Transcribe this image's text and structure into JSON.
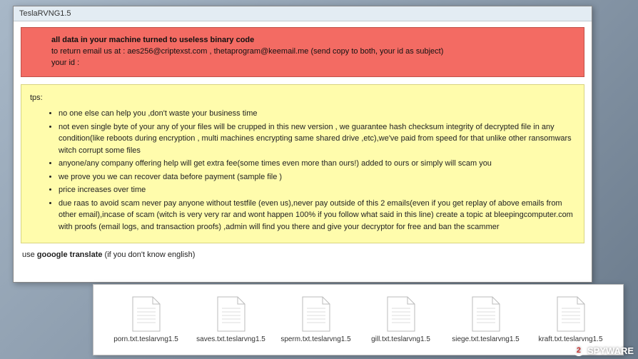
{
  "window": {
    "title": "TeslaRVNG1.5"
  },
  "red_banner": {
    "headline": "all data in your machine turned to useless binary code",
    "line2": "to return email us at : aes256@criptexst.com , thetaprogram@keemail.me (send copy to both, your id as subject)",
    "line3": "your id :"
  },
  "tips": {
    "label": "tps:",
    "items": [
      "no one else can help you ,don't waste your business time",
      "not even single byte of your any of your files will be crupped in this new version , we guarantee hash checksum integrity of decrypted file in any condition(like reboots during encryption , multi machines encrypting same shared drive ,etc),we've paid from speed for that unlike other ransomwars witch corrupt some files",
      "anyone/any company offering help will get extra fee(some times even more than ours!) added to ours or simply will scam you",
      "we prove you we can recover data before payment (sample file )",
      "price increases over time",
      "due raas to avoid scam never pay anyone without testfile (even us),never pay outside of this 2 emails(even if you get replay of above emails from other email),incase of scam (witch is very very rar and wont happen 100% if you follow what said in this line) create a topic at bleepingcomputer.com with proofs (email logs, and transaction proofs) ,admin will find you there and give your decryptor for free and ban the scammer"
    ]
  },
  "footer": {
    "prefix": "use ",
    "bold": "gooogle translate",
    "suffix": " (if you don't know english)"
  },
  "files": [
    {
      "name": "porn.txt.teslarvng1.5"
    },
    {
      "name": "saves.txt.teslarvng1.5"
    },
    {
      "name": "sperm.txt.teslarvng1.5"
    },
    {
      "name": "gill.txt.teslarvng1.5"
    },
    {
      "name": "siege.txt.teslarvng1.5"
    },
    {
      "name": "kraft.txt.teslarvng1.5"
    }
  ],
  "watermark": {
    "num": "2",
    "text": "SPYWARE"
  }
}
